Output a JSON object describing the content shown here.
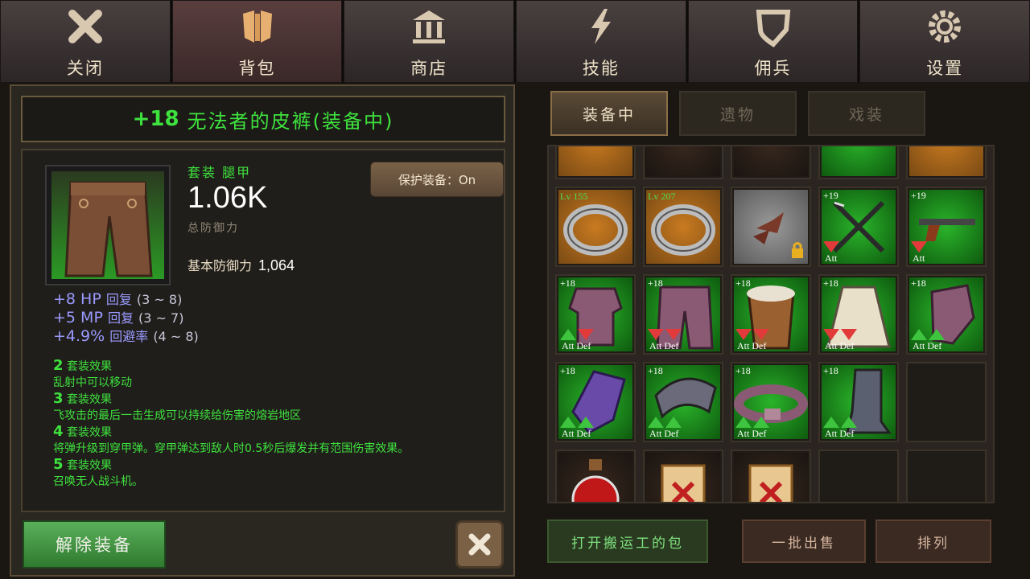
{
  "nav": {
    "tabs": [
      {
        "label": "关闭",
        "icon": "close-icon"
      },
      {
        "label": "背包",
        "icon": "backpack-icon"
      },
      {
        "label": "商店",
        "icon": "shop-icon"
      },
      {
        "label": "技能",
        "icon": "lightning-icon"
      },
      {
        "label": "佣兵",
        "icon": "shield-icon"
      },
      {
        "label": "设置",
        "icon": "gear-icon"
      }
    ],
    "active_index": 1
  },
  "item": {
    "level": "+18",
    "name": "无法者的皮裤(装备中)",
    "set_type": "套装 腿甲",
    "total_defense": "1.06K",
    "total_defense_label": "总防御力",
    "protect_label": "保护装备：On",
    "base_def_label": "基本防御力",
    "base_def_value": "1,064",
    "stats": [
      {
        "value": "+8 HP",
        "label": "回复",
        "range": "(3 ~ 8)"
      },
      {
        "value": "+5 MP",
        "label": "回复",
        "range": "(3 ~ 7)"
      },
      {
        "value": "+4.9%",
        "label": "回避率",
        "range": "(4 ~ 8)"
      }
    ],
    "set_effects": [
      {
        "num": "2",
        "title": "套装效果",
        "text": "乱射中可以移动"
      },
      {
        "num": "3",
        "title": "套装效果",
        "text": "飞攻击的最后一击生成可以持续给伤害的熔岩地区"
      },
      {
        "num": "4",
        "title": "套装效果",
        "text": "将弹升级到穿甲弹。穿甲弹达到敌人时0.5秒后爆发并有范围伤害效果。"
      },
      {
        "num": "5",
        "title": "套装效果",
        "text": "召唤无人战斗机。"
      }
    ],
    "unequip_label": "解除装备"
  },
  "inventory": {
    "tabs": [
      "装备中",
      "遗物",
      "戏装"
    ],
    "active_tab": 0,
    "slots": [
      {
        "type": "ring",
        "lv": "Lv 155",
        "bg": "orange"
      },
      {
        "type": "ring",
        "lv": "Lv 207",
        "bg": "orange"
      },
      {
        "type": "wings",
        "lock": true,
        "bg": "grey"
      },
      {
        "type": "crossbow",
        "plus": "+19",
        "bg": "green",
        "arrows": [
          "dn"
        ],
        "labels": "Att"
      },
      {
        "type": "gun",
        "plus": "+19",
        "bg": "green",
        "arrows": [
          "dn"
        ],
        "labels": "Att"
      },
      {
        "type": "armor",
        "plus": "+18",
        "bg": "green",
        "arrows": [
          "up",
          "dn"
        ],
        "labels": "Att  Def"
      },
      {
        "type": "pants",
        "plus": "+18",
        "bg": "green",
        "arrows": [
          "dn",
          "dn"
        ],
        "labels": "Att  Def"
      },
      {
        "type": "fur",
        "plus": "+18",
        "bg": "green",
        "arrows": [
          "dn",
          "dn"
        ],
        "labels": "Att  Def"
      },
      {
        "type": "skirt",
        "plus": "+18",
        "bg": "green",
        "arrows": [
          "dn",
          "dn"
        ],
        "labels": "Att  Def"
      },
      {
        "type": "gauntlet",
        "plus": "+18",
        "bg": "green",
        "arrows": [
          "up",
          "up"
        ],
        "labels": "Att  Def"
      },
      {
        "type": "claw",
        "plus": "+18",
        "bg": "green",
        "arrows": [
          "up",
          "up"
        ],
        "labels": "Att  Def"
      },
      {
        "type": "collar",
        "plus": "+18",
        "bg": "green",
        "arrows": [
          "up",
          "up"
        ],
        "labels": "Att  Def"
      },
      {
        "type": "belt",
        "plus": "+18",
        "bg": "green",
        "arrows": [
          "up",
          "up"
        ],
        "labels": "Att  Def"
      },
      {
        "type": "boot",
        "plus": "+18",
        "bg": "green",
        "arrows": [
          "up",
          "up"
        ],
        "labels": "Att  Def"
      },
      {
        "type": "empty"
      },
      {
        "type": "potion",
        "bg": "dark"
      },
      {
        "type": "scroll",
        "bg": "dark"
      },
      {
        "type": "scroll",
        "bg": "dark"
      },
      {
        "type": "empty"
      },
      {
        "type": "empty"
      }
    ]
  },
  "buttons": {
    "open_pack": "打开搬运工的包",
    "bulk_sell": "一批出售",
    "sort": "排列"
  },
  "colors": {
    "green_text": "#3ee23e",
    "accent": "#8a6e48"
  }
}
